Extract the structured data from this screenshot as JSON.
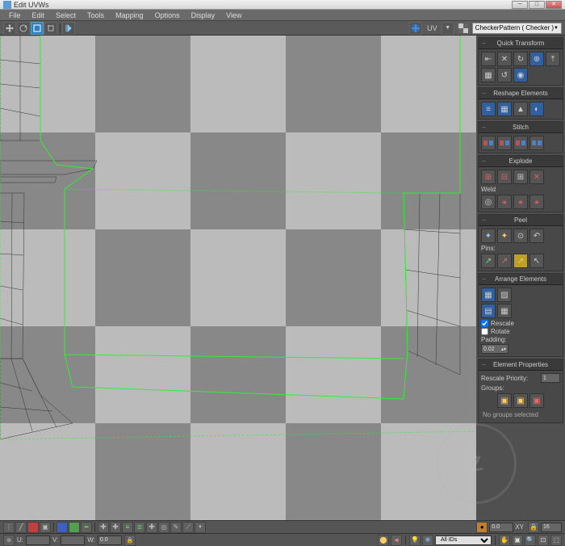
{
  "window": {
    "title": "Edit UVWs"
  },
  "menu": [
    "File",
    "Edit",
    "Select",
    "Tools",
    "Mapping",
    "Options",
    "Display",
    "View"
  ],
  "toolbar": {
    "uv_label": "UV",
    "checker_combo": "CheckerPattern  ( Checker )"
  },
  "panels": {
    "quick_transform": {
      "title": "Quick Transform"
    },
    "reshape": {
      "title": "Reshape Elements"
    },
    "stitch": {
      "title": "Stitch"
    },
    "explode": {
      "title": "Explode",
      "weld_label": "Weld"
    },
    "peel": {
      "title": "Peel",
      "pins_label": "Pins:"
    },
    "arrange": {
      "title": "Arrange Elements",
      "rescale": "Rescale",
      "rotate": "Rotate",
      "padding": "Padding:",
      "padding_val": "0.02"
    },
    "eprops": {
      "title": "Element Properties",
      "rescale_priority": "Rescale Priority:",
      "priority_val": "1",
      "groups": "Groups:",
      "no_groups": "No groups selected"
    }
  },
  "bottom": {
    "u_label": "U:",
    "u_val": "",
    "v_label": "V:",
    "v_val": "",
    "w_label": "W:",
    "w_val": "0.0",
    "ids_combo": "All IDs",
    "xy_label": "XY",
    "angle_val": "16",
    "other_val": "0.0"
  }
}
